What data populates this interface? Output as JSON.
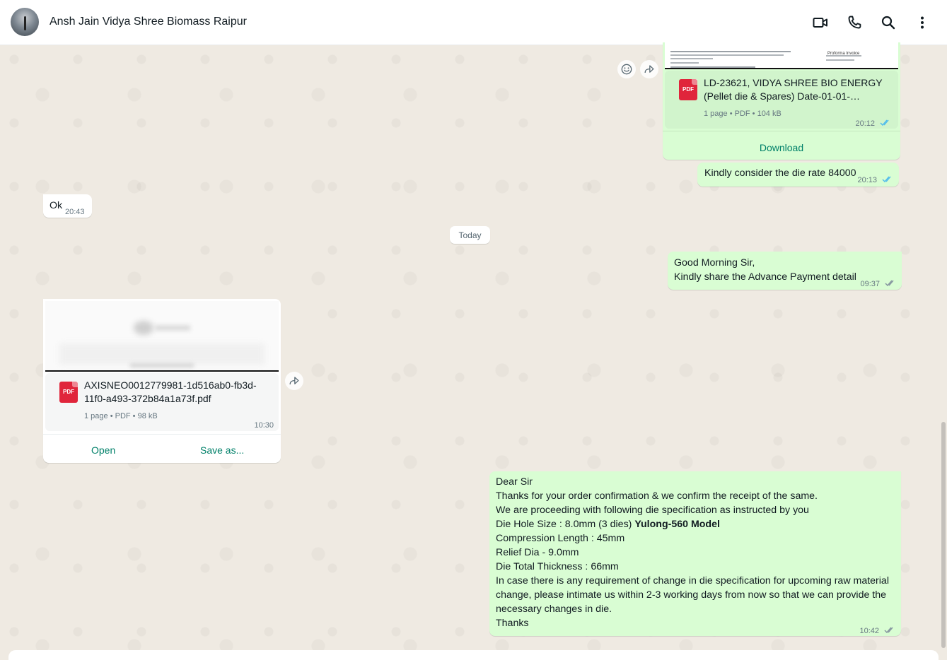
{
  "header": {
    "title": "Ansh Jain Vidya Shree Biomass Raipur",
    "icons": [
      "video-call-icon",
      "phone-icon",
      "search-icon",
      "more-options-icon"
    ]
  },
  "messages": {
    "doc1": {
      "preview_header": "Proforma Invoice",
      "name_line1": "LD-23621, VIDYA SHREE BIO ENERGY",
      "name_line2": "(Pellet die & Spares) Date-01-01-…",
      "meta": "1 page • PDF • 104 kB",
      "time": "20:12",
      "pdf_label": "PDF",
      "download_label": "Download"
    },
    "die_rate": {
      "text": "Kindly consider the die rate 84000",
      "time": "20:13"
    },
    "ok": {
      "text": "Ok",
      "time": "20:43"
    },
    "date_divider": "Today",
    "good_morning": {
      "line1": "Good Morning Sir,",
      "line2": "Kindly share the Advance Payment detail",
      "time": "09:37"
    },
    "doc2": {
      "name_line1": "AXISNEO0012779981-1d516ab0-fb3d-",
      "name_line2": "11f0-a493-372b84a1a73f.pdf",
      "meta": "1 page • PDF • 98 kB",
      "time": "10:30",
      "pdf_label": "PDF",
      "open_label": "Open",
      "save_label": "Save as..."
    },
    "confirmation": {
      "l1": "Dear Sir",
      "l2": "Thanks for your order confirmation & we confirm the receipt of the same.",
      "l3": "We are proceeding with following die specification as instructed by you",
      "l4a": "Die Hole Size : 8.0mm (3 dies) ",
      "l4b": "Yulong-560 Model",
      "l5": "Compression Length : 45mm",
      "l6": "Relief Dia - 9.0mm",
      "l7": "Die Total Thickness : 66mm",
      "l8": "In case there is any requirement of change in die specification for upcoming raw material",
      "l9": "change, please intimate us within 2-3 working days from now so that we can provide the",
      "l10": "necessary changes in die.",
      "l11": "Thanks",
      "time": "10:42"
    }
  },
  "colors": {
    "outgoing": "#d9fdd3",
    "incoming": "#ffffff",
    "accent": "#008069",
    "read_ticks": "#53bdeb",
    "pdf_red": "#e0253b"
  }
}
